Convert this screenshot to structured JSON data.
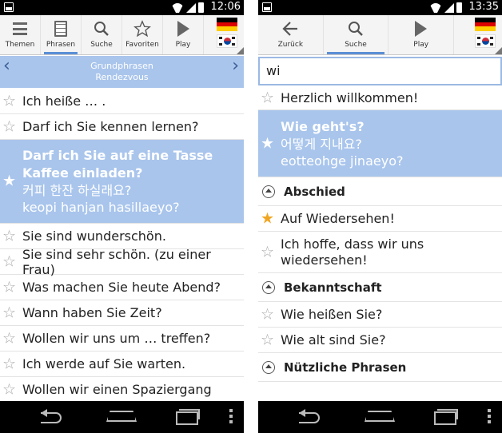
{
  "left": {
    "status": {
      "time": "12:06"
    },
    "toolbar": {
      "themen": "Themen",
      "phrasen": "Phrasen",
      "suche": "Suche",
      "favoriten": "Favoriten",
      "play": "Play"
    },
    "nav": {
      "line1": "Grundphrasen",
      "line2": "Rendezvous"
    },
    "rows": [
      "Ich heiße … .",
      "Darf ich Sie kennen lernen?",
      "Sie sind wunderschön.",
      "Sie sind sehr schön. (zu einer Frau)",
      "Was machen Sie heute Abend?",
      "Wann haben Sie Zeit?",
      "Wollen wir uns um … treffen?",
      "Ich werde auf Sie warten.",
      "Wollen wir einen Spaziergang"
    ],
    "selected": {
      "german": "Darf ich Sie auf eine Tasse Kaffee einladen?",
      "korean": "커피 한잔 하실래요?",
      "roman": "keopi hanjan hasillaeyo?"
    }
  },
  "right": {
    "status": {
      "time": "13:35"
    },
    "toolbar": {
      "zurueck": "Zurück",
      "suche": "Suche",
      "play": "Play"
    },
    "search": {
      "value": "wi"
    },
    "rows": {
      "r1": "Herzlich willkommen!",
      "selected_german": "Wie geht's?",
      "selected_korean": "어떻게 지내요?",
      "selected_roman": "eotteohge jinaeyo?",
      "section1": "Abschied",
      "r2": "Auf Wiedersehen!",
      "r3": "Ich hoffe, dass wir uns wiedersehen!",
      "section2": "Bekanntschaft",
      "r4": "Wie heißen Sie?",
      "r5": "Wie alt sind Sie?",
      "section3": "Nützliche Phrasen"
    }
  },
  "colors": {
    "accent": "#a9c5ec",
    "tab_indicator": "#5b8fd6",
    "favorite_star": "#f0a623"
  },
  "icons": [
    "list-icon",
    "document-icon",
    "search-icon",
    "star-icon",
    "play-icon",
    "back-arrow-icon",
    "german-flag-icon",
    "korean-flag-icon"
  ]
}
